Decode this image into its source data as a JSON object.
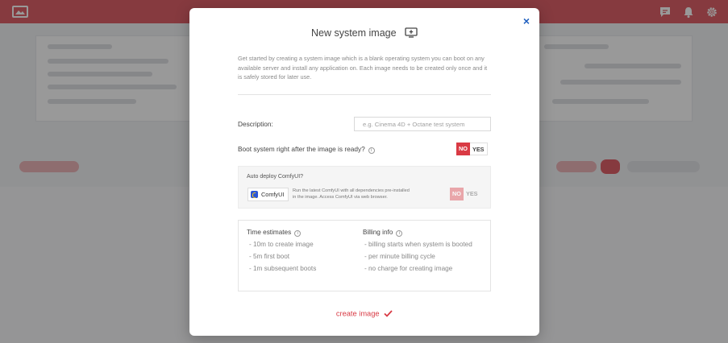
{
  "modal": {
    "title": "New system image",
    "close_symbol": "×",
    "intro": "Get started by creating a system image which is a blank operating system you can boot on any available server and install any application on. Each image needs to be created only once and it is safely stored for later use.",
    "description_label": "Description:",
    "description_placeholder": "e.g. Cinema 4D + Octane test system",
    "description_value": "",
    "boot_label": "Boot system right after the image is ready?",
    "boot_no": "NO",
    "boot_yes": "YES",
    "boot_selected": "NO",
    "auto_deploy": {
      "title": "Auto deploy ComfyUI?",
      "app_name": "ComfyUI",
      "description": "Run the latest ComfyUI with all dependencies pre-installed in the image. Access ComfyUI via web browser.",
      "no": "NO",
      "yes": "YES",
      "selected": "NO",
      "disabled": true
    },
    "time_estimates": {
      "title": "Time estimates",
      "items": [
        "- 10m to create image",
        "- 5m first boot",
        "- 1m subsequent boots"
      ]
    },
    "billing_info": {
      "title": "Billing info",
      "items": [
        "- billing starts when system is booted",
        "- per minute billing cycle",
        "- no charge for creating image"
      ]
    },
    "create_label": "create image"
  },
  "icons": {
    "logo": "logo-icon",
    "chat": "chat-icon",
    "bell": "bell-icon",
    "settings": "gear-icon",
    "title": "monitor-plus-icon",
    "info": "info-icon",
    "create": "checkmark-icon"
  },
  "colors": {
    "brand": "#d83a44",
    "close": "#1f5fbf"
  }
}
